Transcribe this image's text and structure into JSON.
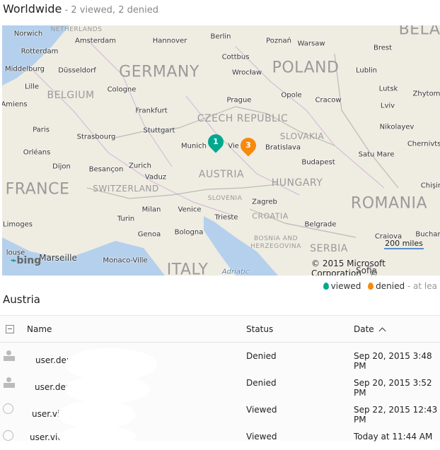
{
  "header": {
    "title": "Worldwide",
    "subtitle": " - 2 viewed, 2 denied"
  },
  "map": {
    "countries": [
      "NETHERLANDS",
      "GERMANY",
      "POLAND",
      "BELGIUM",
      "CZECH REPUBLIC",
      "SLOVAKIA",
      "AUSTRIA",
      "HUNGARY",
      "FRANCE",
      "SWITZERLAND",
      "SLOVENIA",
      "CROATIA",
      "ROMANIA",
      "SERBIA",
      "BOSNIA AND",
      "HERZEGOVINA",
      "ITALY",
      "BELA"
    ],
    "cities": [
      "Norwich",
      "Amsterdam",
      "Hannover",
      "Berlin",
      "Poznań",
      "Warsaw",
      "Brest",
      "Rotterdam",
      "Cottbus",
      "Middelburg",
      "Düsseldorf",
      "Wrocław",
      "Lublin",
      "Lille",
      "Cologne",
      "Opole",
      "Lutsk",
      "Zhytomyr",
      "Amiens",
      "Prague",
      "Cracow",
      "Lviv",
      "Frankfurt",
      "Paris",
      "Strasbourg",
      "Stuttgart",
      "Nikolayev",
      "Munich",
      "Vie",
      "Bratislava",
      "Chernivtsi",
      "Orléans",
      "Satu Mare",
      "Dijon",
      "Besançon",
      "Zurich",
      "Budapest",
      "Vaduz",
      "Chişin",
      "Limoges",
      "Milan",
      "Venice",
      "Zagreb",
      "Trieste",
      "Turin",
      "Genoa",
      "Bologna",
      "Belgrade",
      "Craiova",
      "Buchar",
      "Marseille",
      "Monaco-Ville",
      "louse",
      "Sofia",
      "Adriatic"
    ],
    "pins": [
      {
        "label": "1",
        "status": "viewed",
        "color": "#00a88f"
      },
      {
        "label": "3",
        "status": "denied",
        "color": "#f7890c"
      }
    ],
    "scale": "200 miles",
    "copyright": "© 2015 Microsoft Corporation",
    "copyright2": "©",
    "logo": "bing"
  },
  "legend": {
    "viewed": "viewed",
    "denied": "denied",
    "note": " - at lea",
    "viewed_color": "#00a88f",
    "denied_color": "#f7890c"
  },
  "section": {
    "title": "Austria"
  },
  "table": {
    "columns": {
      "name": "Name",
      "status": "Status",
      "date": "Date"
    },
    "sort_icon": "chevron-up-icon",
    "rows": [
      {
        "icon": "user-icon",
        "name": "user.deniec",
        "status": "Denied",
        "date": "Sep 20, 2015 3:48 PM"
      },
      {
        "icon": "user-icon",
        "name": "user.denie(",
        "status": "Denied",
        "date": "Sep 20, 2015 3:52 PM"
      },
      {
        "icon": "globe-icon",
        "name": "user.view",
        "status": "Viewed",
        "date": "Sep 22, 2015 12:43 PM"
      },
      {
        "icon": "globe-icon",
        "name": "user.view@",
        "status": "Viewed",
        "date": "Today at 11:44 AM"
      }
    ]
  }
}
